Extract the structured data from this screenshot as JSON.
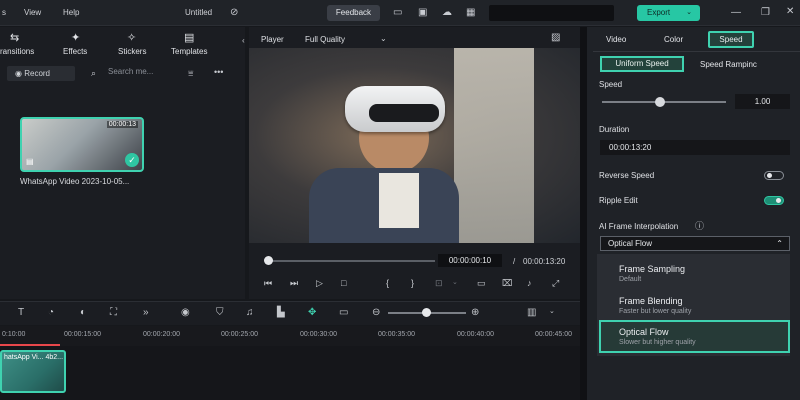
{
  "menu": {
    "items": [
      "s",
      "View",
      "Help"
    ],
    "project_title": "Untitled",
    "feedback_label": "Feedback",
    "export_label": "Export"
  },
  "media_toolbar": {
    "tabs": [
      {
        "label": "ransitions",
        "icon": "transitions-icon"
      },
      {
        "label": "Effects",
        "icon": "effects-icon"
      },
      {
        "label": "Stickers",
        "icon": "stickers-icon"
      },
      {
        "label": "Templates",
        "icon": "templates-icon"
      }
    ],
    "record_label": "Record",
    "search_placeholder": "Search me..."
  },
  "media_item": {
    "duration": "00:00:13",
    "name": "WhatsApp Video 2023-10-05..."
  },
  "player": {
    "label": "Player",
    "quality": "Full Quality",
    "current_time": "00:00:00:10",
    "separator": "/",
    "total_time": "00:00:13:20"
  },
  "right_panel": {
    "tabs": [
      "Video",
      "Color",
      "Speed"
    ],
    "active_tab": "Speed",
    "subtabs": [
      "Uniform Speed",
      "Speed Rampinc"
    ],
    "speed_label": "Speed",
    "speed_value": "1.00",
    "speed_slider_fraction": 0.47,
    "duration_label": "Duration",
    "duration_value": "00:00:13:20",
    "reverse_label": "Reverse Speed",
    "reverse_on": false,
    "ripple_label": "Ripple Edit",
    "ripple_on": true,
    "ai_label": "AI Frame Interpolation",
    "select_value": "Optical Flow",
    "options": [
      {
        "title": "Frame Sampling",
        "subtitle": "Default"
      },
      {
        "title": "Frame Blending",
        "subtitle": "Faster but lower quality"
      },
      {
        "title": "Optical Flow",
        "subtitle": "Slower but higher quality"
      }
    ]
  },
  "timeline": {
    "ticks": [
      "0:10:00",
      "00:00:15:00",
      "00:00:20:00",
      "00:00:25:00",
      "00:00:30:00",
      "00:00:35:00",
      "00:00:40:00",
      "00:00:45:00"
    ],
    "clip_name": "hatsApp Vi... 4b2..."
  },
  "colors": {
    "accent": "#3fd2b0",
    "export_bg": "#27c7a4",
    "playhead": "#e8474b"
  }
}
